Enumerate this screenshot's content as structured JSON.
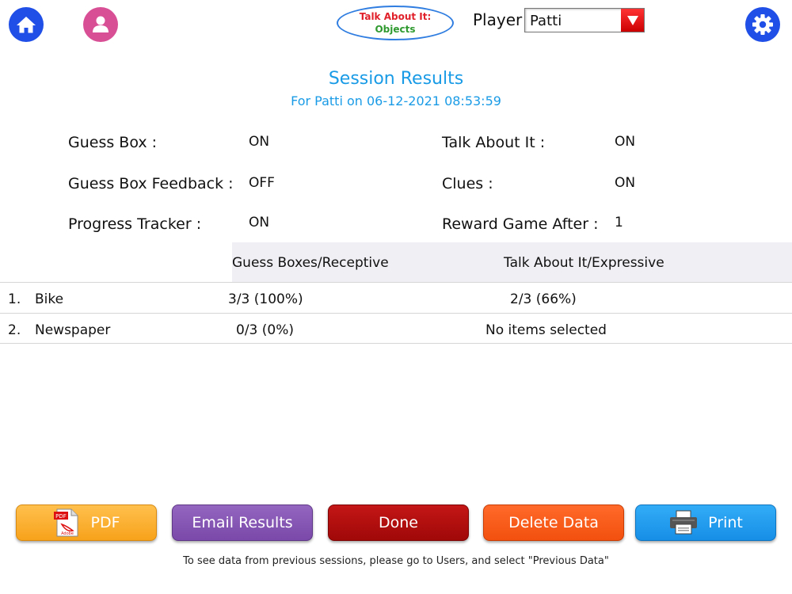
{
  "header": {
    "logo_line1": "Talk About It:",
    "logo_line2": "Objects",
    "player_label": "Player",
    "player_value": "Patti",
    "icons": [
      "home-icon",
      "user-icon",
      "gear-icon",
      "dropdown-arrow-icon"
    ],
    "accent": "#1f4fe6",
    "user_color": "#d94f96"
  },
  "results": {
    "title": "Session Results",
    "subtitle": "For Patti on 06-12-2021 08:53:59"
  },
  "settings": {
    "guess_box_label": "Guess Box  :",
    "guess_box_value": "ON",
    "guess_box_feedback_label": "Guess Box Feedback :",
    "guess_box_feedback_value": "OFF",
    "progress_tracker_label": "Progress Tracker :",
    "progress_tracker_value": "ON",
    "talk_about_it_label": "Talk About It :",
    "talk_about_it_value": "ON",
    "clues_label": "Clues :",
    "clues_value": "ON",
    "reward_game_label": "Reward Game After :",
    "reward_game_value": "1"
  },
  "table": {
    "col_receptive": "Guess Boxes/Receptive",
    "col_expressive": "Talk About It/Expressive",
    "rows": [
      {
        "num": "1.",
        "item": "Bike",
        "receptive": "3/3  (100%)",
        "expressive": "2/3  (66%)"
      },
      {
        "num": "2.",
        "item": "Newspaper",
        "receptive": "0/3  (0%)",
        "expressive": "No items selected"
      }
    ]
  },
  "buttons": {
    "pdf": "PDF",
    "email": "Email Results",
    "done": "Done",
    "delete": "Delete Data",
    "print": "Print",
    "pdf_icon_text": "PDF",
    "pdf_icon_sub": "Adobe"
  },
  "footer": {
    "note": "To see data from previous sessions, please go to Users, and select \"Previous Data\""
  }
}
